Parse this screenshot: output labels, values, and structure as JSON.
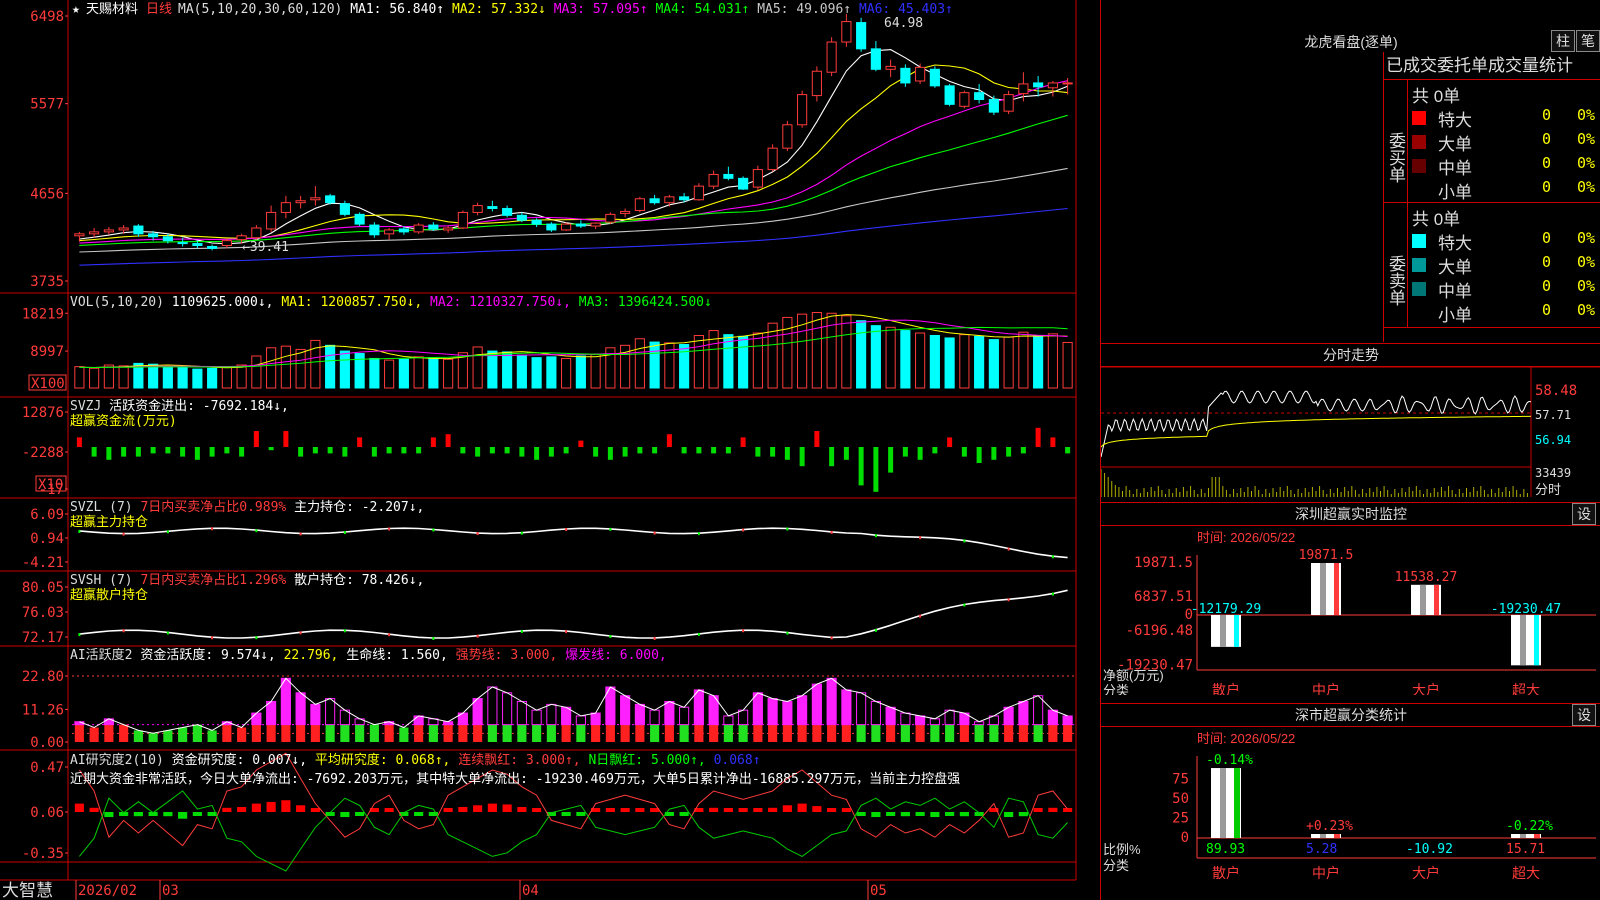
{
  "header": {
    "star": "★",
    "stock_name": "天赐材料",
    "period": "日线",
    "ma_params": "MA(5,10,20,30,60,120)",
    "ma": [
      {
        "label": "MA1: 56.840↑",
        "color": "#ffffff"
      },
      {
        "label": "MA2: 57.332↓",
        "color": "#ffff00"
      },
      {
        "label": "MA3: 57.095↑",
        "color": "#ff00ff"
      },
      {
        "label": "MA4: 54.031↑",
        "color": "#00ff00"
      },
      {
        "label": "MA5: 49.096↑",
        "color": "#c8c8c8"
      },
      {
        "label": "MA6: 45.403↑",
        "color": "#3030ff"
      }
    ],
    "high_mark": "64.98",
    "low_mark": "←39.41"
  },
  "price_axis": [
    "6498",
    "5577",
    "4656",
    "3735"
  ],
  "vol": {
    "header": [
      {
        "t": "VOL(5,10,20)",
        "c": "#dddddd"
      },
      {
        "t": "1109625.000↓,",
        "c": "#ffffff"
      },
      {
        "t": "MA1: 1200857.750↓,",
        "c": "#ffff00"
      },
      {
        "t": "MA2: 1210327.750↓,",
        "c": "#ff00ff"
      },
      {
        "t": "MA3: 1396424.500↓",
        "c": "#00ff00"
      }
    ],
    "axis": [
      "18219",
      "8997"
    ],
    "unit": "X100"
  },
  "svzj": {
    "header": [
      {
        "t": "SVZJ",
        "c": "#dddddd"
      },
      {
        "t": "活跃资金进出: -7692.184↓,",
        "c": "#ffffff"
      }
    ],
    "sub": "超赢资金流(万元)",
    "axis": [
      "12876",
      "-2288",
      "-17"
    ],
    "unit": "X10"
  },
  "svzl": {
    "header": [
      {
        "t": "SVZL (7)",
        "c": "#dddddd"
      },
      {
        "t": "7日内买卖净占比0.989%",
        "c": "#ff3b3b"
      },
      {
        "t": "主力持仓: -2.207↓,",
        "c": "#ffffff"
      }
    ],
    "sub": "超赢主力持仓",
    "axis": [
      "6.09",
      "0.94",
      "-4.21"
    ]
  },
  "svsh": {
    "header": [
      {
        "t": "SVSH (7)",
        "c": "#dddddd"
      },
      {
        "t": "7日内买卖净占比1.296%",
        "c": "#ff3b3b"
      },
      {
        "t": "散户持仓: 78.426↓,",
        "c": "#ffffff"
      }
    ],
    "sub": "超赢散户持仓",
    "axis": [
      "80.05",
      "76.03",
      "72.17"
    ]
  },
  "ai1": {
    "header": [
      {
        "t": "AI活跃度2",
        "c": "#dddddd"
      },
      {
        "t": "资金活跃度: 9.574↓,",
        "c": "#ffffff"
      },
      {
        "t": "22.796,",
        "c": "#ffff00"
      },
      {
        "t": "生命线: 1.560,",
        "c": "#ffffff"
      },
      {
        "t": "强势线: 3.000,",
        "c": "#ff3b3b"
      },
      {
        "t": "爆发线: 6.000,",
        "c": "#ff00ff"
      }
    ],
    "axis": [
      "22.80",
      "11.26",
      "0.00"
    ]
  },
  "ai2": {
    "header": [
      {
        "t": "AI研究度2(10)",
        "c": "#dddddd"
      },
      {
        "t": "资金研究度: 0.007↓,",
        "c": "#ffffff"
      },
      {
        "t": "平均研究度: 0.068↑,",
        "c": "#ffff00"
      },
      {
        "t": "连续飘红: 3.000↑,",
        "c": "#ff3b3b"
      },
      {
        "t": "N日飘红: 5.000↑,",
        "c": "#00ff00"
      },
      {
        "t": "0.068↑",
        "c": "#3030ff"
      }
    ],
    "note": "近期大资金非常活跃，今日大单净流出: -7692.203万元，其中特大单净流出: -19230.469万元，大单5日累计净出-16885.297万元，当前主力控盘强",
    "axis": [
      "0.47",
      "0.06",
      "-0.35"
    ]
  },
  "date_axis": {
    "brand": "大智慧",
    "labels": [
      "2026/02",
      "03",
      "04",
      "05"
    ]
  },
  "right": {
    "dragon_title": "龙虎看盘(逐单)",
    "tab_bar": "柱",
    "tab_pen": "笔",
    "stats_title": "已成交委托单成交量统计",
    "buy": {
      "label": "委买单",
      "total": "共 0单",
      "rows": [
        {
          "name": "特大",
          "n": "0",
          "p": "0%",
          "color": "#ff0000"
        },
        {
          "name": "大单",
          "n": "0",
          "p": "0%",
          "color": "#990000"
        },
        {
          "name": "中单",
          "n": "0",
          "p": "0%",
          "color": "#660000"
        },
        {
          "name": "小单",
          "n": "0",
          "p": "0%",
          "color": "#000000"
        }
      ]
    },
    "sell": {
      "label": "委卖单",
      "total": "共 0单",
      "rows": [
        {
          "name": "特大",
          "n": "0",
          "p": "0%",
          "color": "#00ffff"
        },
        {
          "name": "大单",
          "n": "0",
          "p": "0%",
          "color": "#009999"
        },
        {
          "name": "中单",
          "n": "0",
          "p": "0%",
          "color": "#007777"
        },
        {
          "name": "小单",
          "n": "0",
          "p": "0%",
          "color": "#000000"
        }
      ]
    },
    "intraday": {
      "title": "分时走势",
      "axis": [
        "58.48",
        "57.71",
        "56.94"
      ],
      "vol_label": "33439",
      "unit": "分时"
    },
    "monitor": {
      "title": "深圳超赢实时监控",
      "set": "设",
      "time": "时间: 2026/05/22",
      "axis": [
        "19871.5",
        "6837.51",
        "0",
        "-6196.48",
        "-19230.47"
      ],
      "side_label": "净额(万元)",
      "cat_label": "分类",
      "cats": [
        "散户",
        "中户",
        "大户",
        "超大"
      ],
      "values": [
        -12179.29,
        19871.5,
        11538.27,
        -19230.47
      ],
      "value_labels": [
        "-12179.29",
        "19871.5",
        "11538.27",
        "-19230.47"
      ]
    },
    "classify": {
      "title": "深市超赢分类统计",
      "set": "设",
      "time": "时间: 2026/05/22",
      "axis": [
        "75",
        "50",
        "25",
        "0"
      ],
      "side_label": "比例%",
      "cat_label": "分类",
      "cats": [
        "散户",
        "中户",
        "大户",
        "超大"
      ],
      "values": [
        89.93,
        5.28,
        -10.92,
        15.71
      ],
      "bottom_labels": [
        "89.93",
        "5.28",
        "-10.92",
        "15.71"
      ],
      "top_labels": [
        "-0.14%",
        "+0.23%",
        "",
        "-0.22%"
      ]
    }
  },
  "chart_data": {
    "type": "candlestick",
    "ylim": [
      37.35,
      64.98
    ],
    "ohlc": [
      [
        42.2,
        42.6,
        41.6,
        42.4
      ],
      [
        42.4,
        43.0,
        42.0,
        42.6
      ],
      [
        42.6,
        43.1,
        42.3,
        42.8
      ],
      [
        42.8,
        43.3,
        42.4,
        43.0
      ],
      [
        43.2,
        43.4,
        42.1,
        42.4
      ],
      [
        42.4,
        42.7,
        41.7,
        42.1
      ],
      [
        42.1,
        42.4,
        41.4,
        41.7
      ],
      [
        41.5,
        42.0,
        41.1,
        41.4
      ],
      [
        41.4,
        41.7,
        40.9,
        41.2
      ],
      [
        41.1,
        41.3,
        40.7,
        40.9
      ],
      [
        41.2,
        41.9,
        40.9,
        41.7
      ],
      [
        41.8,
        42.4,
        41.4,
        42.2
      ],
      [
        42.0,
        43.3,
        41.8,
        43.0
      ],
      [
        42.9,
        45.3,
        42.6,
        44.6
      ],
      [
        44.6,
        46.3,
        44.0,
        45.6
      ],
      [
        45.6,
        46.3,
        45.0,
        45.8
      ],
      [
        45.9,
        47.3,
        45.3,
        46.1
      ],
      [
        46.3,
        46.5,
        45.4,
        45.6
      ],
      [
        45.5,
        45.8,
        44.2,
        44.4
      ],
      [
        44.4,
        44.6,
        43.2,
        43.4
      ],
      [
        43.3,
        43.6,
        42.0,
        42.3
      ],
      [
        42.4,
        43.0,
        41.8,
        42.8
      ],
      [
        42.9,
        43.2,
        42.3,
        42.6
      ],
      [
        42.6,
        43.5,
        42.4,
        43.3
      ],
      [
        43.3,
        43.6,
        42.7,
        42.9
      ],
      [
        42.8,
        43.2,
        42.5,
        43.0
      ],
      [
        43.0,
        44.8,
        42.9,
        44.6
      ],
      [
        44.6,
        45.6,
        44.3,
        45.3
      ],
      [
        45.2,
        45.8,
        44.7,
        45.0
      ],
      [
        45.0,
        45.3,
        44.1,
        44.3
      ],
      [
        44.3,
        44.6,
        43.6,
        43.8
      ],
      [
        43.8,
        44.0,
        43.1,
        43.4
      ],
      [
        43.4,
        43.6,
        42.6,
        42.8
      ],
      [
        42.8,
        43.6,
        42.7,
        43.4
      ],
      [
        43.4,
        43.8,
        43.0,
        43.2
      ],
      [
        43.2,
        43.6,
        42.9,
        43.5
      ],
      [
        43.6,
        44.6,
        43.4,
        44.4
      ],
      [
        44.5,
        45.0,
        44.1,
        44.7
      ],
      [
        44.8,
        46.2,
        44.6,
        46.0
      ],
      [
        46.0,
        46.4,
        45.4,
        45.6
      ],
      [
        45.6,
        46.4,
        45.2,
        46.2
      ],
      [
        46.2,
        46.6,
        45.6,
        45.9
      ],
      [
        45.9,
        47.6,
        45.8,
        47.3
      ],
      [
        47.3,
        48.9,
        47.0,
        48.5
      ],
      [
        48.5,
        49.3,
        47.9,
        48.1
      ],
      [
        48.1,
        48.3,
        46.9,
        47.0
      ],
      [
        47.2,
        49.4,
        46.9,
        49.0
      ],
      [
        49.0,
        51.6,
        48.8,
        51.2
      ],
      [
        51.2,
        54.0,
        50.9,
        53.6
      ],
      [
        53.6,
        57.1,
        53.3,
        56.7
      ],
      [
        56.6,
        59.6,
        56.0,
        59.1
      ],
      [
        59.0,
        62.6,
        58.6,
        62.1
      ],
      [
        62.1,
        64.98,
        61.6,
        64.2
      ],
      [
        64.1,
        64.6,
        61.1,
        61.4
      ],
      [
        61.4,
        62.2,
        59.1,
        59.3
      ],
      [
        59.3,
        60.3,
        58.5,
        59.6
      ],
      [
        59.4,
        59.8,
        57.5,
        57.9
      ],
      [
        58.1,
        59.9,
        57.8,
        59.5
      ],
      [
        59.3,
        59.6,
        57.4,
        57.6
      ],
      [
        57.6,
        57.8,
        55.5,
        55.7
      ],
      [
        55.5,
        57.1,
        55.3,
        56.9
      ],
      [
        56.9,
        57.8,
        55.8,
        56.2
      ],
      [
        56.2,
        56.6,
        54.6,
        54.9
      ],
      [
        55.0,
        57.1,
        54.7,
        56.7
      ],
      [
        56.8,
        59.0,
        56.0,
        57.8
      ],
      [
        57.9,
        58.6,
        56.5,
        57.5
      ],
      [
        57.4,
        58.1,
        56.5,
        57.9
      ],
      [
        57.8,
        58.4,
        56.7,
        57.9
      ]
    ],
    "volume": [
      5200,
      4800,
      5600,
      5400,
      6000,
      5800,
      5200,
      5000,
      4600,
      4800,
      5200,
      5600,
      7800,
      9800,
      10200,
      9400,
      11600,
      10400,
      9000,
      8400,
      7200,
      6800,
      7000,
      7600,
      7400,
      7000,
      8600,
      10000,
      9000,
      8800,
      8000,
      7400,
      7600,
      7200,
      7800,
      8200,
      9800,
      10400,
      12000,
      11200,
      11000,
      10600,
      12800,
      14000,
      13000,
      12600,
      13400,
      15800,
      17200,
      18000,
      18400,
      18219,
      17600,
      16400,
      15200,
      14800,
      14000,
      13400,
      12800,
      12200,
      13000,
      12600,
      11800,
      12400,
      13600,
      12800,
      13200,
      11096
    ],
    "svzj": [
      3,
      -3,
      -4,
      -3,
      -3,
      -2,
      -2,
      -3,
      -4,
      -3,
      -2,
      -3,
      5,
      -1,
      5,
      -3,
      -2,
      -2,
      -3,
      3,
      -3,
      -2,
      -2,
      -2,
      3,
      4,
      -2,
      -3,
      -2,
      -2,
      -3,
      -4,
      -3,
      -2,
      2,
      -3,
      -4,
      -3,
      -2,
      -2,
      4,
      -2,
      -2,
      -2,
      -2,
      3,
      -3,
      -3,
      -4,
      -6,
      5,
      -6,
      -4,
      -12,
      -14,
      -8,
      -3,
      -4,
      -2,
      3,
      -3,
      -5,
      -4,
      -3,
      -2,
      6,
      3,
      -2
    ],
    "ai_activity": [
      7,
      5,
      8,
      6,
      4,
      3,
      4,
      5,
      6,
      4,
      7,
      5,
      10,
      14,
      22,
      17,
      13,
      15,
      11,
      8,
      6,
      7,
      5,
      9,
      8,
      7,
      10,
      15,
      19,
      17,
      14,
      11,
      13,
      12,
      9,
      10,
      19,
      16,
      13,
      11,
      14,
      12,
      18,
      16,
      9,
      11,
      17,
      15,
      14,
      16,
      20,
      22,
      18,
      17,
      14,
      12,
      10,
      9,
      8,
      11,
      10,
      7,
      9,
      12,
      14,
      16,
      11,
      9
    ],
    "ai_research": [
      0.1,
      0.05,
      -0.06,
      -0.02,
      -0.05,
      -0.02,
      -0.05,
      -0.08,
      -0.03,
      -0.04,
      0.05,
      0.06,
      0.1,
      0.12,
      0.14,
      0.08,
      0.02,
      -0.02,
      -0.06,
      -0.04,
      0.02,
      0.04,
      -0.02,
      -0.04,
      -0.03,
      0.04,
      0.06,
      0.08,
      0.1,
      0.09,
      0.06,
      0.04,
      -0.02,
      -0.03,
      -0.04,
      0.02,
      0.03,
      0.04,
      0.03,
      0.02,
      -0.03,
      -0.04,
      0.02,
      0.05,
      0.04,
      0.03,
      0.04,
      0.05,
      0.08,
      0.1,
      0.07,
      0.04,
      0.03,
      -0.04,
      -0.06,
      -0.03,
      -0.05,
      -0.04,
      -0.06,
      -0.03,
      -0.05,
      -0.02,
      0.02,
      -0.06,
      -0.05,
      0.04,
      0.05,
      0.007
    ]
  }
}
